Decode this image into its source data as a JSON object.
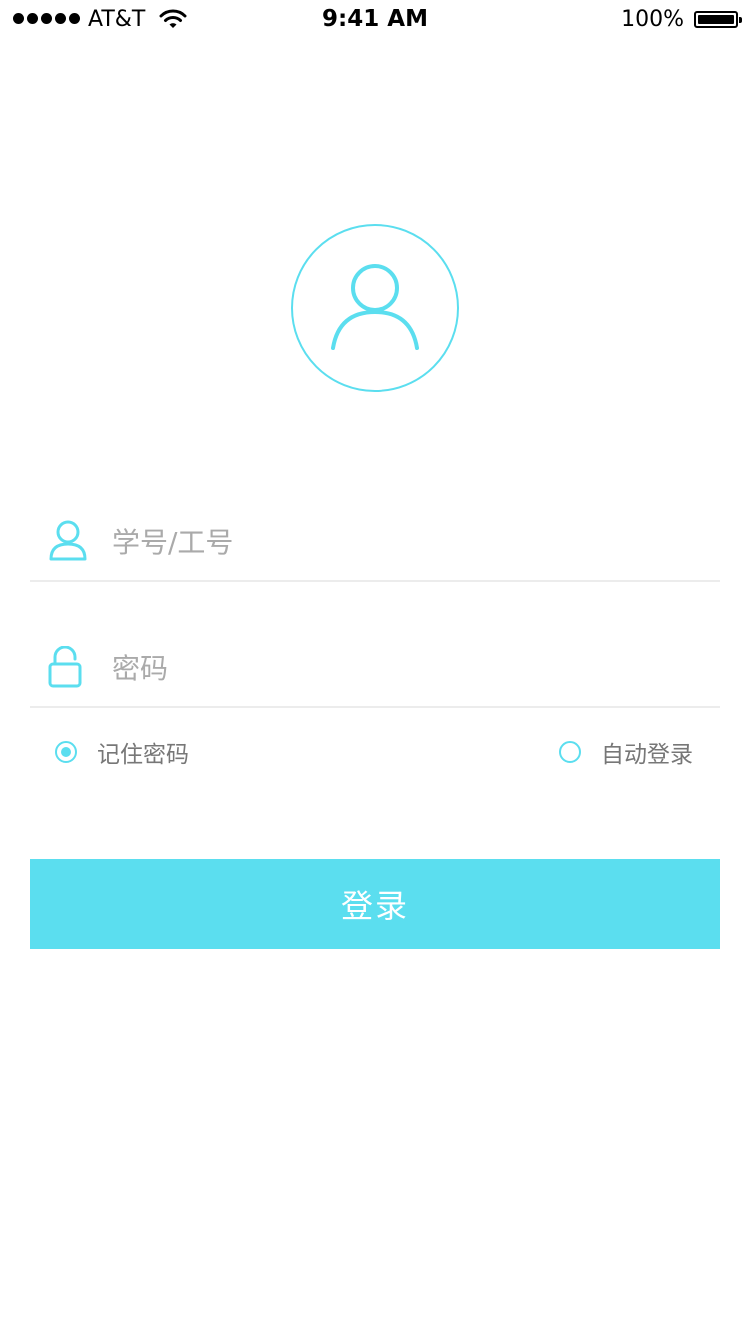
{
  "status_bar": {
    "carrier": "AT&T",
    "time": "9:41 AM",
    "battery": "100%"
  },
  "colors": {
    "accent": "#5bdeef",
    "divider": "#ececec",
    "placeholder": "#aaaaaa"
  },
  "icons": {
    "avatar": "user-avatar-icon",
    "username": "user-icon",
    "password": "lock-icon"
  },
  "form": {
    "username_placeholder": "学号/工号",
    "username_value": "",
    "password_placeholder": "密码",
    "password_value": "",
    "remember_password": {
      "label": "记住密码",
      "checked": true
    },
    "auto_login": {
      "label": "自动登录",
      "checked": false
    },
    "login_button": "登录"
  }
}
